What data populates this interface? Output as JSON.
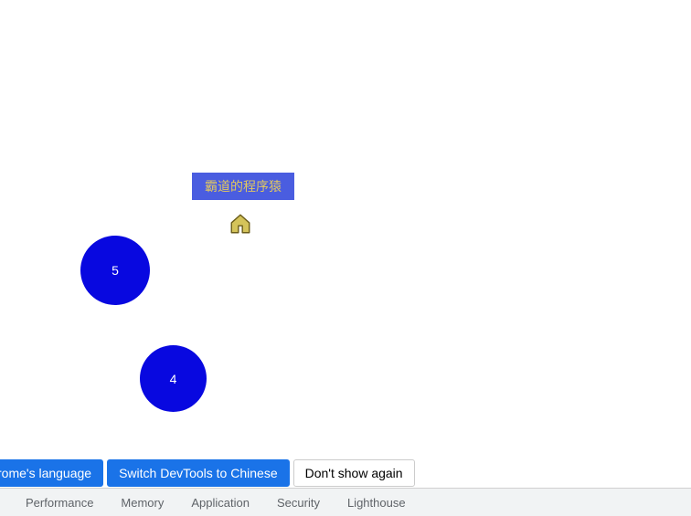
{
  "canvas": {
    "label_text": "霸道的程序猿",
    "circle5_value": "5",
    "circle4_value": "4"
  },
  "notice": {
    "btn1_label": "rome's language",
    "btn2_label": "Switch DevTools to Chinese",
    "btn3_label": "Don't show again"
  },
  "devtools": {
    "tabs": {
      "performance": "Performance",
      "memory": "Memory",
      "application": "Application",
      "security": "Security",
      "lighthouse": "Lighthouse"
    }
  }
}
